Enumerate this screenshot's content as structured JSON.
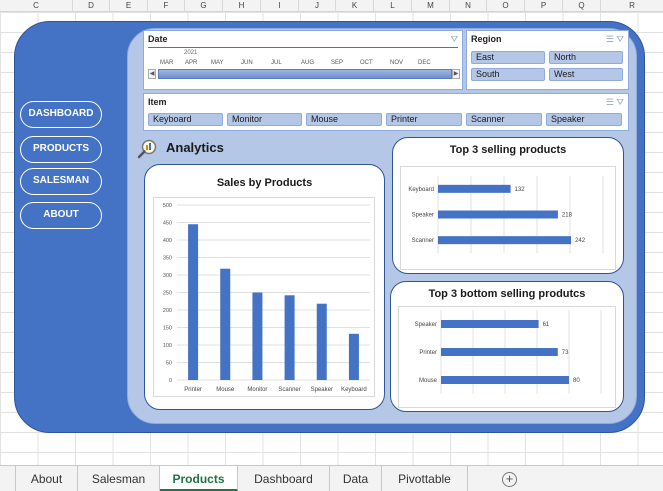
{
  "columns": [
    "C",
    "D",
    "E",
    "F",
    "G",
    "H",
    "I",
    "J",
    "K",
    "L",
    "M",
    "N",
    "O",
    "P",
    "Q",
    "R"
  ],
  "nav": {
    "dashboard": "DASHBOARD",
    "products": "PRODUCTS",
    "salesman": "SALESMAN",
    "about": "ABOUT"
  },
  "timeline": {
    "title": "Date",
    "year": "2021",
    "months": [
      "MAR",
      "APR",
      "MAY",
      "JUN",
      "JUL",
      "AUG",
      "SEP",
      "OCT",
      "NOV",
      "DEC"
    ]
  },
  "region_slicer": {
    "title": "Region",
    "items": [
      "East",
      "North",
      "South",
      "West"
    ]
  },
  "item_slicer": {
    "title": "Item",
    "items": [
      "Keyboard",
      "Monitor",
      "Mouse",
      "Printer",
      "Scanner",
      "Speaker"
    ]
  },
  "analytics": {
    "title": "Analytics"
  },
  "icons": {
    "filter": "filter-clear-icon",
    "multiselect": "multi-select-icon",
    "analytics": "magnifier-chart-icon",
    "add_sheet": "plus-circle-icon"
  },
  "colors": {
    "bar": "#4472c4",
    "outer": "#4472c4",
    "inner": "#b4c7e7",
    "active_tab": "#217346"
  },
  "chart_data": [
    {
      "type": "bar",
      "title": "Sales by Products",
      "categories": [
        "Printer",
        "Mouse",
        "Monitor",
        "Scanner",
        "Speaker",
        "Keyboard"
      ],
      "values": [
        445,
        318,
        250,
        242,
        218,
        132
      ],
      "ylim": [
        0,
        500
      ],
      "yticks": [
        0,
        50,
        100,
        150,
        200,
        250,
        300,
        350,
        400,
        450,
        500
      ],
      "grid": true
    },
    {
      "type": "bar",
      "orientation": "horizontal",
      "title": "Top 3 selling products",
      "categories": [
        "Keyboard",
        "Speaker",
        "Scanner"
      ],
      "values": [
        132,
        218,
        242
      ],
      "xlim": [
        0,
        300
      ],
      "grid": true
    },
    {
      "type": "bar",
      "orientation": "horizontal",
      "title": "Top 3 bottom selling produtcs",
      "categories": [
        "Speaker",
        "Printer",
        "Mouse"
      ],
      "values": [
        61,
        73,
        80
      ],
      "xlim": [
        0,
        100
      ],
      "grid": true
    }
  ],
  "tabs": [
    "About",
    "Salesman",
    "Products",
    "Dashboard",
    "Data",
    "Pivottable"
  ],
  "active_tab": "Products"
}
